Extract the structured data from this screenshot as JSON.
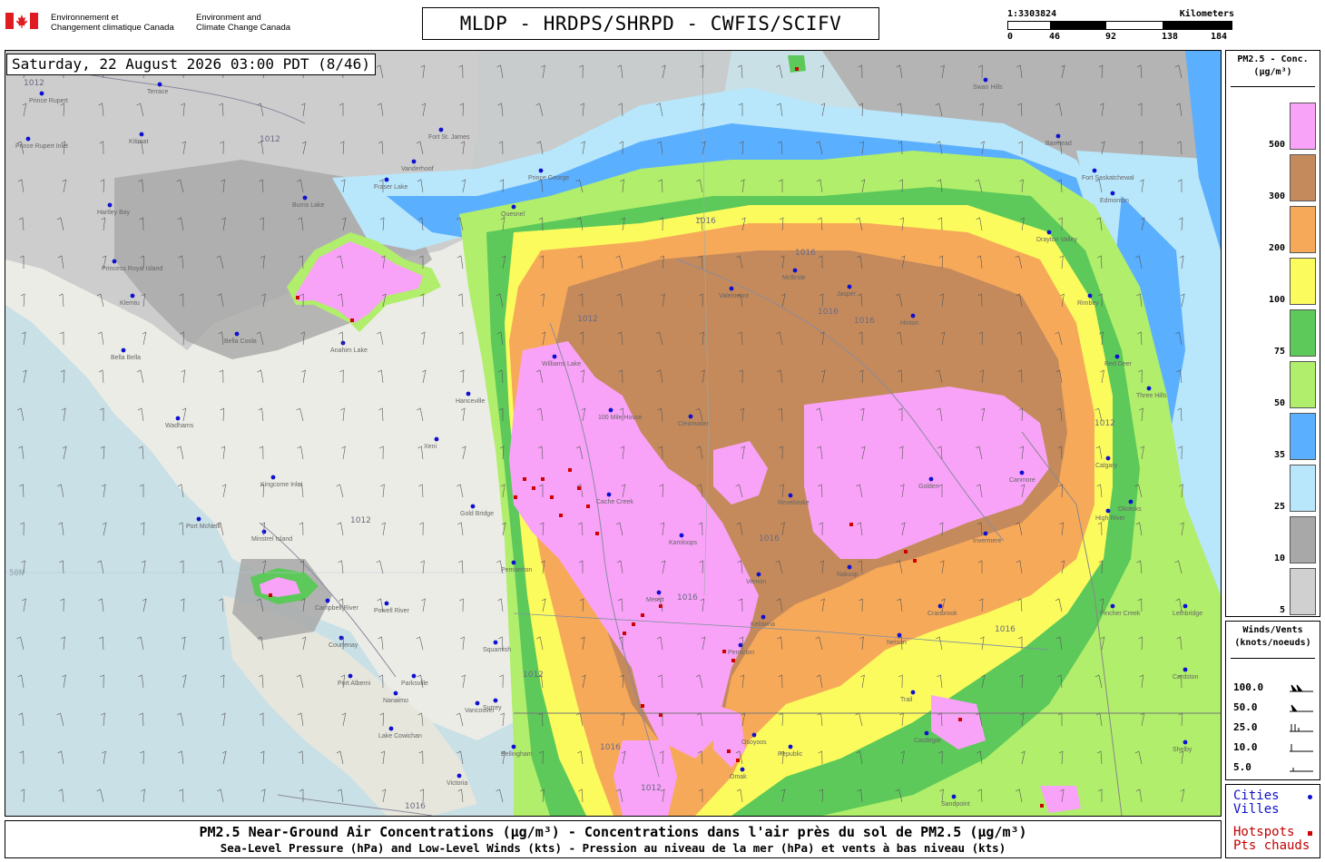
{
  "header": {
    "department_fr": [
      "Environnement et",
      "Changement climatique Canada"
    ],
    "department_en": [
      "Environment and",
      "Climate Change Canada"
    ],
    "title": "MLDP - HRDPS/SHRPD - CWFIS/SCIFV"
  },
  "scale": {
    "ratio": "1:3303824",
    "unit": "Kilometers",
    "ticks": [
      "0",
      "46",
      "92",
      "138",
      "184"
    ]
  },
  "map": {
    "datetime": "Saturday, 22 August 2026 03:00 PDT (8/46)",
    "place_labels": [
      "Prince Rupert",
      "Terrace",
      "Prince Rupert Inlet",
      "Kitimat",
      "Hartley Bay",
      "Princess Royal Island",
      "Klemtu",
      "Bella Bella",
      "Bella Coola",
      "Anahim Lake",
      "Wadhams",
      "Xeni",
      "Kingcome Inlet",
      "Port McNeill",
      "Minstrel Island",
      "Campbell River",
      "Powell River",
      "Courtenay",
      "Port Alberni",
      "Parksville",
      "Nanaimo",
      "Lake Cowichan",
      "Victoria",
      "Vancouver",
      "Surrey",
      "Bellingham",
      "Squamish",
      "Pemberton",
      "Gold Bridge",
      "Hanceville",
      "Williams Lake",
      "100 Mile House",
      "Clearwater",
      "Cache Creek",
      "Kamloops",
      "Merritt",
      "Vernon",
      "Kelowna",
      "Penticton",
      "Osoyoos",
      "Republic",
      "Omak",
      "Revelstoke",
      "Nakusp",
      "Nelson",
      "Trail",
      "Castlegar",
      "Sandpoint",
      "Cranbrook",
      "Invermere",
      "Golden",
      "Canmore",
      "Calgary",
      "High River",
      "Okotoks",
      "Red Deer",
      "Rimbey",
      "Drayton Valley",
      "Edmonton",
      "Fort Saskatchewal",
      "Valemount",
      "McBride",
      "Jasper",
      "Hinton",
      "Vanderhoof",
      "Prince George",
      "Quesnel",
      "Fraser Lake",
      "Burns Lake",
      "Swan Hills",
      "Barrhead",
      "Fort St. James",
      "Lethbridge",
      "Cardston",
      "Pincher Creek",
      "Three Hills",
      "Shelby"
    ],
    "isobars": [
      "1012",
      "1016"
    ],
    "lat_label": "50N"
  },
  "legend": {
    "title": [
      "PM2.5 - Conc.",
      "(µg/m³)"
    ],
    "levels": [
      {
        "value": "500",
        "color": "#f8a3f7"
      },
      {
        "value": "300",
        "color": "#c48a5c"
      },
      {
        "value": "200",
        "color": "#f7a95a"
      },
      {
        "value": "100",
        "color": "#fbfb5d"
      },
      {
        "value": "75",
        "color": "#5cc95a"
      },
      {
        "value": "50",
        "color": "#b0ee6b"
      },
      {
        "value": "35",
        "color": "#5bafff"
      },
      {
        "value": "25",
        "color": "#b8e6fa"
      },
      {
        "value": "10",
        "color": "#a8a8a8"
      },
      {
        "value": "5",
        "color": "#d0d0d0"
      }
    ]
  },
  "winds": {
    "title": [
      "Winds/Vents",
      "(knots/noeuds)"
    ],
    "rows": [
      "100.0",
      "50.0",
      "25.0",
      "10.0",
      "5.0"
    ]
  },
  "markers": {
    "cities": [
      "Cities",
      "Villes"
    ],
    "hotspots": [
      "Hotspots",
      "Pts chauds"
    ],
    "city_color": "#1010d0",
    "hotspot_color": "#d00000"
  },
  "caption": {
    "line1": "PM2.5 Near-Ground Air Concentrations (µg/m³) - Concentrations dans l'air près du sol de PM2.5 (µg/m³)",
    "line2": "Sea-Level Pressure (hPa) and Low-Level Winds (kts) - Pression au niveau de la mer (hPa) et vents à bas niveau (kts)"
  }
}
